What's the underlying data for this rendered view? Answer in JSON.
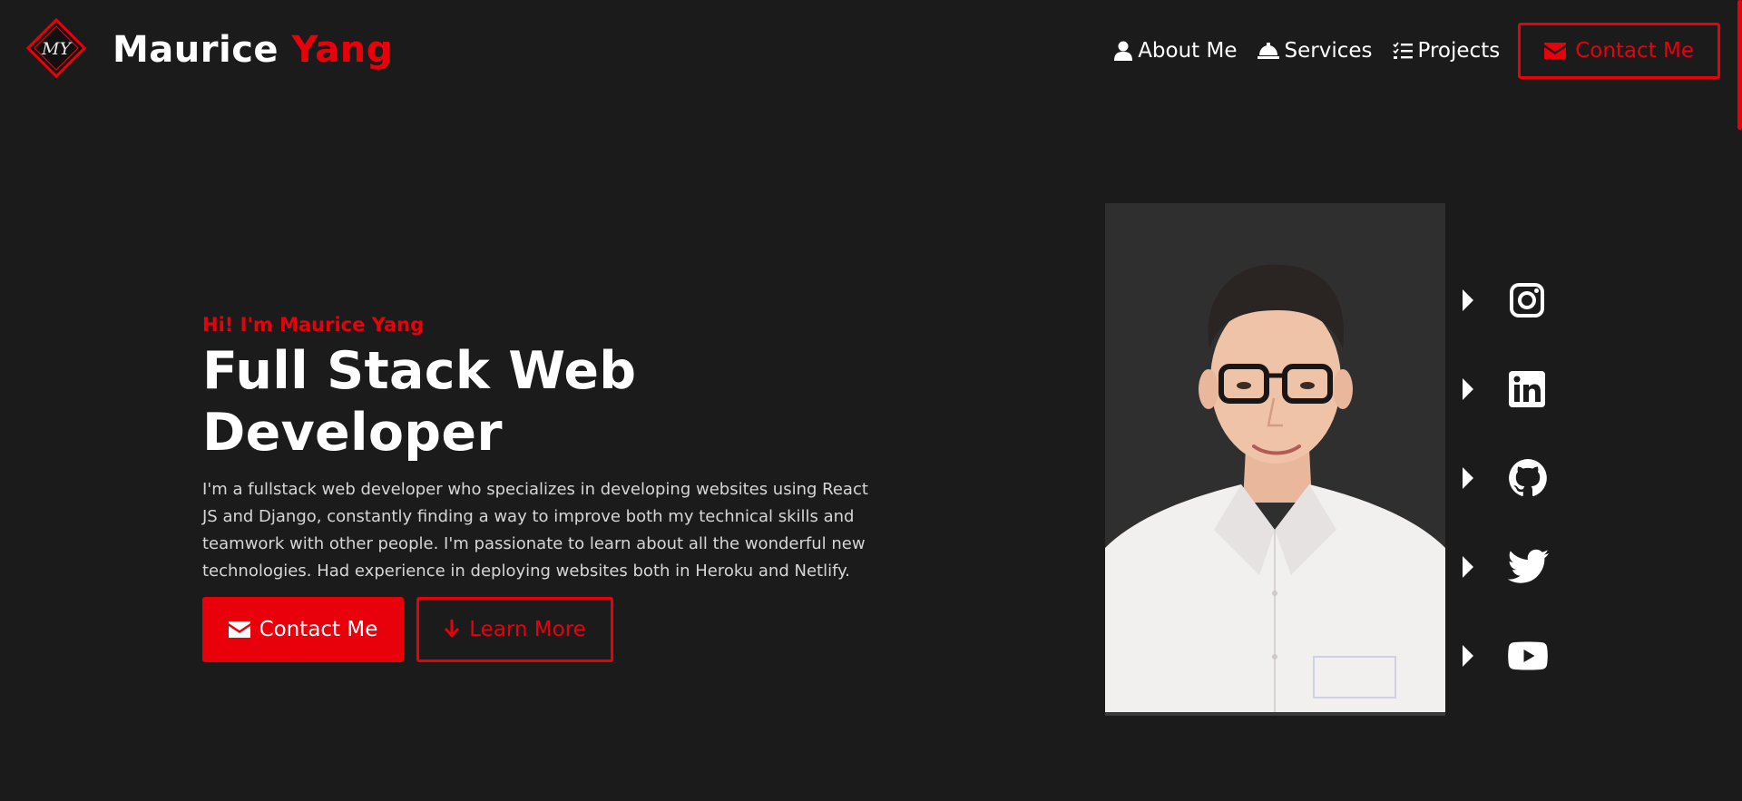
{
  "brand": {
    "first": "Maurice",
    "last": "Yang",
    "logo_text": "MY",
    "accent_color": "#e8000b"
  },
  "nav": {
    "items": [
      {
        "label": "About Me",
        "icon": "user-icon"
      },
      {
        "label": "Services",
        "icon": "bell-icon"
      },
      {
        "label": "Projects",
        "icon": "list-icon"
      }
    ],
    "contact": {
      "label": "Contact Me",
      "icon": "envelope-icon"
    }
  },
  "hero": {
    "greeting": "Hi! I'm Maurice Yang",
    "title": "Full Stack Web Developer",
    "description": "I'm a fullstack web developer who specializes in developing websites using React JS and Django, constantly finding a way to improve both my technical skills and teamwork with other people. I'm passionate to learn about all the wonderful new technologies. Had experience in deploying websites both in Heroku and Netlify.",
    "primary_button": {
      "label": "Contact Me",
      "icon": "envelope-icon"
    },
    "secondary_button": {
      "label": "Learn More",
      "icon": "arrow-down-icon"
    }
  },
  "portrait": {
    "alt": "profile-photo"
  },
  "socials": [
    {
      "icon": "instagram-icon"
    },
    {
      "icon": "linkedin-icon"
    },
    {
      "icon": "github-icon"
    },
    {
      "icon": "twitter-icon"
    },
    {
      "icon": "youtube-icon"
    }
  ],
  "colors": {
    "background": "#1b1b1b",
    "accent": "#e8000b",
    "text": "#ffffff"
  }
}
